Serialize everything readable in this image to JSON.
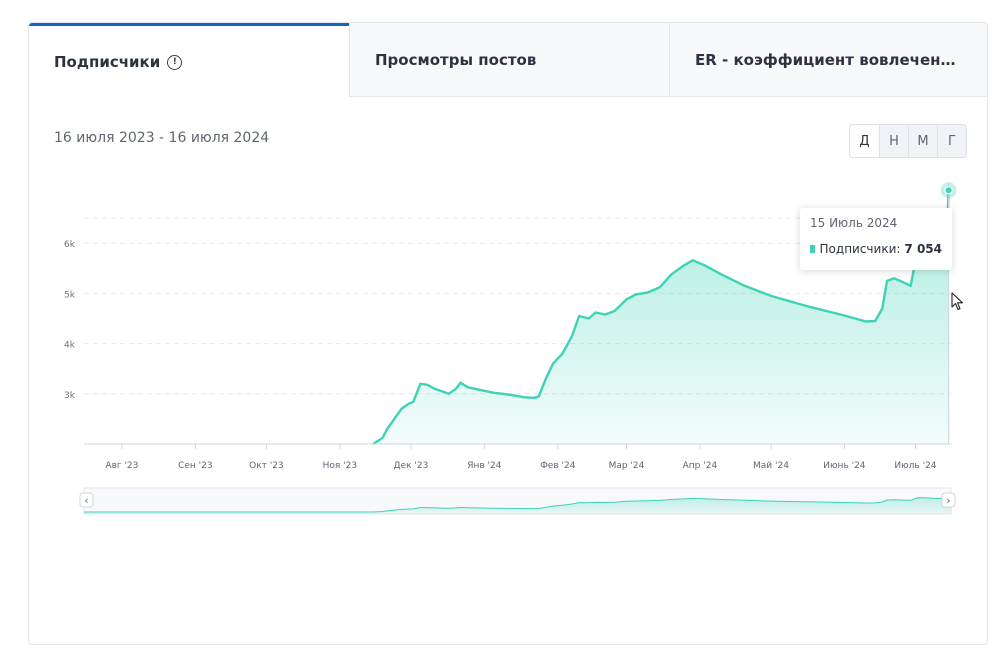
{
  "tabs": [
    {
      "label": "Подписчики",
      "active": true,
      "icon": "info-icon"
    },
    {
      "label": "Просмотры постов",
      "active": false
    },
    {
      "label": "ER - коэффициент вовлеченнос...",
      "active": false
    }
  ],
  "date_range": "16 июля 2023 - 16 июля 2024",
  "period_buttons": [
    {
      "label": "Д",
      "active": true
    },
    {
      "label": "Н",
      "active": false
    },
    {
      "label": "М",
      "active": false
    },
    {
      "label": "Г",
      "active": false
    }
  ],
  "colors": {
    "accent": "#1565c0",
    "series": "#3ed3b4"
  },
  "tooltip": {
    "date": "15 Июль 2024",
    "series": "Подписчики:",
    "value": "7 054"
  },
  "chart_data": {
    "type": "area",
    "x_tick_labels": [
      "Авг '23",
      "Сен '23",
      "Окт '23",
      "Ноя '23",
      "Дек '23",
      "Янв '24",
      "Фев '24",
      "Мар '24",
      "Апр '24",
      "Май '24",
      "Июнь '24",
      "Июль '24"
    ],
    "y_tick_labels": [
      "3k",
      "4k",
      "5k",
      "6k"
    ],
    "y_ticks": [
      3000,
      4000,
      5000,
      6000
    ],
    "ylim": [
      2000,
      7000
    ],
    "grid": true,
    "navigator": true,
    "series": [
      {
        "name": "Подписчики",
        "points": [
          [
            "2023-11-15",
            2000
          ],
          [
            "2023-11-17",
            2060
          ],
          [
            "2023-11-19",
            2120
          ],
          [
            "2023-11-21",
            2300
          ],
          [
            "2023-11-24",
            2500
          ],
          [
            "2023-11-27",
            2700
          ],
          [
            "2023-11-30",
            2800
          ],
          [
            "2023-12-02",
            2840
          ],
          [
            "2023-12-05",
            3200
          ],
          [
            "2023-12-08",
            3180
          ],
          [
            "2023-12-11",
            3100
          ],
          [
            "2023-12-14",
            3050
          ],
          [
            "2023-12-17",
            3000
          ],
          [
            "2023-12-20",
            3100
          ],
          [
            "2023-12-22",
            3220
          ],
          [
            "2023-12-25",
            3130
          ],
          [
            "2023-12-30",
            3080
          ],
          [
            "2024-01-05",
            3020
          ],
          [
            "2024-01-12",
            2980
          ],
          [
            "2024-01-18",
            2930
          ],
          [
            "2024-01-22",
            2920
          ],
          [
            "2024-01-24",
            2950
          ],
          [
            "2024-01-27",
            3300
          ],
          [
            "2024-01-30",
            3600
          ],
          [
            "2024-02-03",
            3800
          ],
          [
            "2024-02-07",
            4150
          ],
          [
            "2024-02-10",
            4550
          ],
          [
            "2024-02-14",
            4500
          ],
          [
            "2024-02-17",
            4620
          ],
          [
            "2024-02-21",
            4580
          ],
          [
            "2024-02-25",
            4650
          ],
          [
            "2024-03-01",
            4880
          ],
          [
            "2024-03-05",
            4980
          ],
          [
            "2024-03-10",
            5020
          ],
          [
            "2024-03-15",
            5120
          ],
          [
            "2024-03-20",
            5380
          ],
          [
            "2024-03-25",
            5550
          ],
          [
            "2024-03-29",
            5660
          ],
          [
            "2024-04-03",
            5560
          ],
          [
            "2024-04-10",
            5380
          ],
          [
            "2024-04-20",
            5150
          ],
          [
            "2024-05-01",
            4950
          ],
          [
            "2024-05-15",
            4760
          ],
          [
            "2024-06-01",
            4560
          ],
          [
            "2024-06-10",
            4440
          ],
          [
            "2024-06-14",
            4450
          ],
          [
            "2024-06-17",
            4700
          ],
          [
            "2024-06-19",
            5250
          ],
          [
            "2024-06-22",
            5300
          ],
          [
            "2024-06-26",
            5220
          ],
          [
            "2024-06-29",
            5150
          ],
          [
            "2024-07-02",
            5900
          ],
          [
            "2024-07-05",
            5850
          ],
          [
            "2024-07-08",
            5700
          ],
          [
            "2024-07-11",
            5650
          ],
          [
            "2024-07-14",
            5800
          ],
          [
            "2024-07-15",
            7054
          ]
        ]
      }
    ]
  }
}
